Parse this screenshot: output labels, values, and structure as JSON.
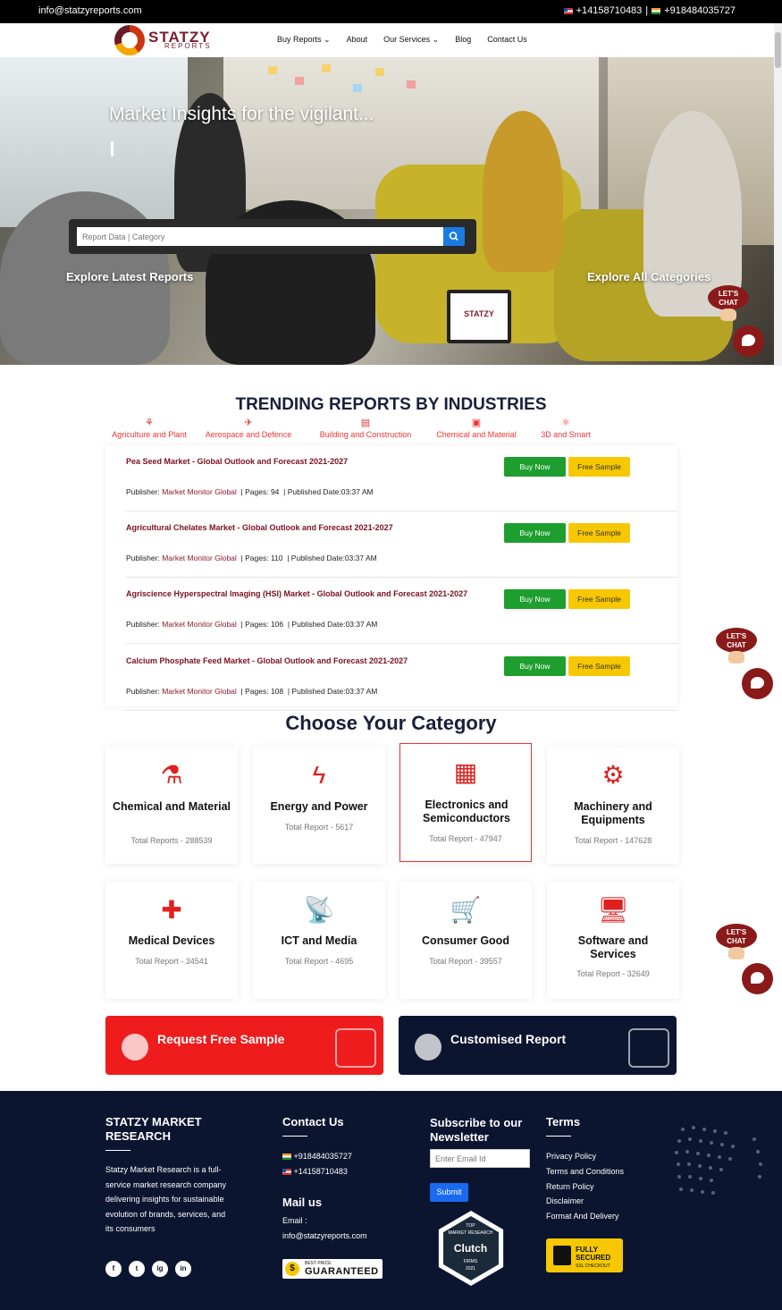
{
  "topbar": {
    "email": "info@statzyreports.com",
    "phone_us": "+14158710483",
    "separator": "|",
    "phone_in": "+918484035727"
  },
  "logo": {
    "name": "STATZY",
    "sub": "REPORTS"
  },
  "nav": [
    {
      "label": "Buy Reports",
      "dropdown": true
    },
    {
      "label": "About",
      "dropdown": false
    },
    {
      "label": "Our Services",
      "dropdown": true
    },
    {
      "label": "Blog",
      "dropdown": false
    },
    {
      "label": "Contact Us",
      "dropdown": false
    }
  ],
  "hero": {
    "title": "Market Insights for the vigilant...",
    "search_placeholder": "Report Data | Category",
    "explore_latest": "Explore Latest Reports",
    "explore_all": "Explore All Categories",
    "laptop_brand": "STATZY"
  },
  "chat": {
    "badge_text": "LET'S CHAT"
  },
  "trending": {
    "title": "TRENDING REPORTS BY INDUSTRIES",
    "tabs": [
      {
        "label": "Agriculture and Plant",
        "icon": "plant-icon"
      },
      {
        "label": "Aerospace and Defence",
        "icon": "airplane-icon"
      },
      {
        "label": "Building and Construction",
        "icon": "building-icon"
      },
      {
        "label": "Chemical and Material",
        "icon": "chip-icon"
      },
      {
        "label": "3D and Smart",
        "icon": "molecule-icon"
      }
    ],
    "buy_label": "Buy Now",
    "free_label": "Free Sample",
    "publisher_label": "Publisher:",
    "reports": [
      {
        "title": "Pea Seed Market - Global Outlook and Forecast 2021-2027",
        "publisher": "Market Monitor Global",
        "pages": "| Pages: 94",
        "date": "| Published Date:03:37 AM"
      },
      {
        "title": "Agricultural Chelates Market - Global Outlook and Forecast 2021-2027",
        "publisher": "Market Monitor Global",
        "pages": "| Pages: 110",
        "date": "| Published Date:03:37 AM"
      },
      {
        "title": "Agriscience Hyperspectral Imaging (HSI) Market - Global Outlook and Forecast 2021-2027",
        "publisher": "Market Monitor Global",
        "pages": "| Pages: 106",
        "date": "| Published Date:03:37 AM"
      },
      {
        "title": "Calcium Phosphate Feed Market - Global Outlook and Forecast 2021-2027",
        "publisher": "Market Monitor Global",
        "pages": "| Pages: 108",
        "date": "| Published Date:03:37 AM"
      }
    ]
  },
  "categories": {
    "title": "Choose Your Category",
    "items": [
      {
        "name": "Chemical and Material",
        "count": "Total Reports - 288539",
        "icon": "flask-icon"
      },
      {
        "name": "Energy and Power",
        "count": "Total Report - 5617",
        "icon": "lightning-icon"
      },
      {
        "name": "Electronics and Semiconductors",
        "count": "Total Report - 47947",
        "icon": "chip-icon"
      },
      {
        "name": "Machinery and Equipments",
        "count": "Total Report - 147628",
        "icon": "gears-icon"
      },
      {
        "name": "Medical Devices",
        "count": "Total Report - 34541",
        "icon": "medical-kit-icon"
      },
      {
        "name": "ICT and Media",
        "count": "Total Report - 4695",
        "icon": "satellite-dish-icon"
      },
      {
        "name": "Consumer Good",
        "count": "Total Report - 39557",
        "icon": "cart-icon"
      },
      {
        "name": "Software and Services",
        "count": "Total Report - 32649",
        "icon": "monitor-icon"
      }
    ]
  },
  "cta": {
    "sample": "Request Free Sample",
    "custom": "Customised Report"
  },
  "footer": {
    "company_title": "STATZY MARKET RESEARCH",
    "company_desc": "Statzy Market Research is a full-service market research company delivering insights for sustainable evolution of brands, services, and its consumers",
    "contact_title": "Contact Us",
    "phone_in": "+918484035727",
    "phone_us": "+14158710483",
    "mail_title": "Mail us",
    "email_label": "Email :",
    "email": "info@statzyreports.com",
    "guarantee_small": "BEST PRICE",
    "guarantee_big": "GUARANTEED",
    "subscribe_title": "Subscribe to our Newsletter",
    "email_placeholder": "Enter Email Id",
    "submit": "Submit",
    "clutch_top": "TOP",
    "clutch_mr": "MARKET RESEARCH",
    "clutch_name": "Clutch",
    "clutch_firms": "FIRMS",
    "clutch_year": "2021",
    "terms_title": "Terms",
    "terms": [
      "Privacy Policy",
      "Terms and Conditions",
      "Return Policy",
      "Disclaimer",
      "Format And Delivery"
    ],
    "secured_l1": "FULLY",
    "secured_l2": "SECURED",
    "secured_l3": "SSL CHECKOUT",
    "socials": [
      "f",
      "t",
      "ig",
      "in"
    ]
  },
  "colors": {
    "brand": "#7a1c2c",
    "accent_red": "#ee1c1c",
    "navy": "#0c1530",
    "buy": "#1e9e2e",
    "free": "#f7c800"
  }
}
